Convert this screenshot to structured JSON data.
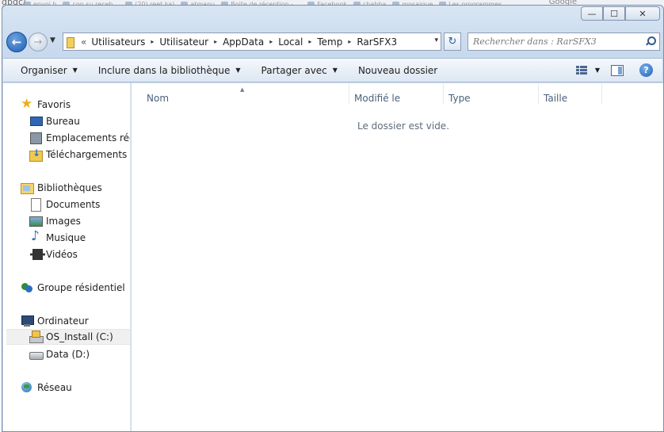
{
  "background_browser": {
    "url_fragment": "gbdc/",
    "tabs": [
      "envoi h",
      "con su receb...",
      "(20) reet ka)",
      "atmanu",
      "Boite de réception - ...",
      "Facebook",
      "chahba",
      "mosaique",
      "Les programmes"
    ],
    "search_hint": "Google"
  },
  "window": {
    "caption": {
      "minimize": "—",
      "maximize": "☐",
      "close": "✕"
    }
  },
  "address": {
    "prefix": "«",
    "crumbs": [
      "Utilisateurs",
      "Utilisateur",
      "AppData",
      "Local",
      "Temp",
      "RarSFX3"
    ],
    "separator": "▸",
    "dropdown": "▾",
    "refresh": "↻"
  },
  "search": {
    "placeholder": "Rechercher dans : RarSFX3"
  },
  "toolbar": {
    "organise": "Organiser",
    "include_library": "Inclure dans la bibliothèque",
    "share": "Partager avec",
    "new_folder": "Nouveau dossier",
    "dropdown": "▼",
    "help": "?"
  },
  "navigation": {
    "favorites": {
      "label": "Favoris",
      "items": [
        "Bureau",
        "Emplacements récents",
        "Téléchargements"
      ]
    },
    "libraries": {
      "label": "Bibliothèques",
      "items": [
        "Documents",
        "Images",
        "Musique",
        "Vidéos"
      ]
    },
    "homegroup": "Groupe résidentiel",
    "computer": {
      "label": "Ordinateur",
      "items": [
        "OS_Install (C:)",
        "Data (D:)"
      ],
      "selected": "OS_Install (C:)"
    },
    "network": "Réseau"
  },
  "columns": [
    "Nom",
    "Modifié le",
    "Type",
    "Taille"
  ],
  "empty_message": "Le dossier est vide."
}
